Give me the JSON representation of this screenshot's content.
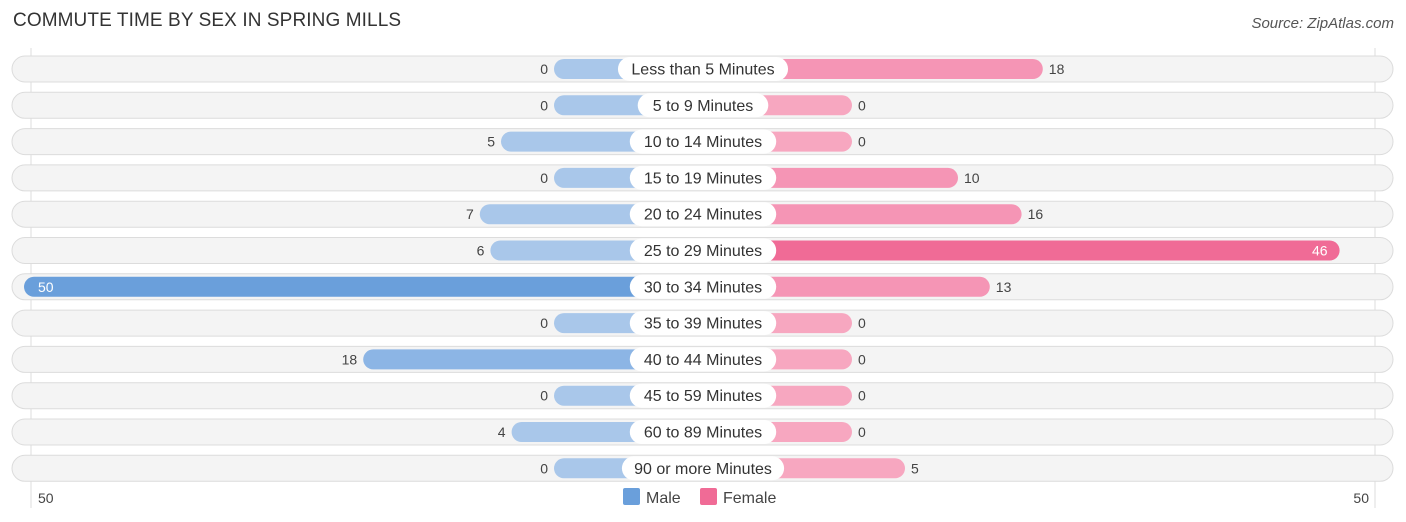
{
  "title": "COMMUTE TIME BY SEX IN SPRING MILLS",
  "source": "Source: ZipAtlas.com",
  "chart_data": {
    "type": "bar",
    "orientation": "horizontal-diverging",
    "title": "COMMUTE TIME BY SEX IN SPRING MILLS",
    "categories": [
      "Less than 5 Minutes",
      "5 to 9 Minutes",
      "10 to 14 Minutes",
      "15 to 19 Minutes",
      "20 to 24 Minutes",
      "25 to 29 Minutes",
      "30 to 34 Minutes",
      "35 to 39 Minutes",
      "40 to 44 Minutes",
      "45 to 59 Minutes",
      "60 to 89 Minutes",
      "90 or more Minutes"
    ],
    "series": [
      {
        "name": "Male",
        "color": "#6a9fdb",
        "light_color": "#a9c7ea",
        "values": [
          0,
          0,
          5,
          0,
          7,
          6,
          50,
          0,
          18,
          0,
          4,
          0
        ]
      },
      {
        "name": "Female",
        "color": "#f06b96",
        "light_color": "#f7a7c0",
        "values": [
          18,
          0,
          0,
          10,
          16,
          46,
          13,
          0,
          0,
          0,
          0,
          5
        ]
      }
    ],
    "axis": {
      "left_label": "50",
      "right_label": "50",
      "max": 50
    },
    "legend": {
      "position": "bottom-center",
      "items": [
        "Male",
        "Female"
      ]
    },
    "xlabel": "",
    "ylabel": ""
  }
}
